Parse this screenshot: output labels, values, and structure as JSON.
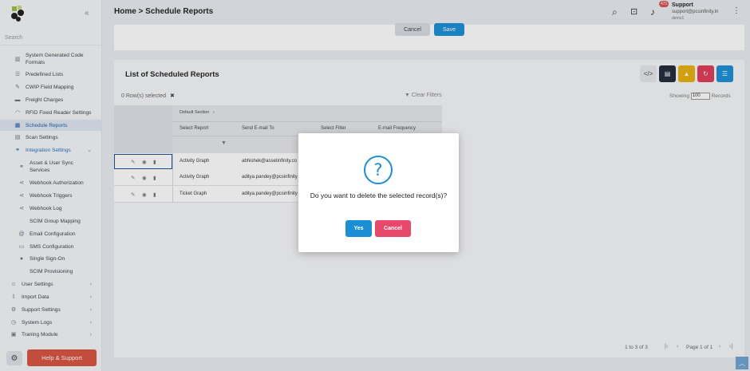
{
  "sidebar": {
    "search_placeholder": "Search",
    "items": [
      {
        "label": "System Generated Code Formats",
        "icon": "barcode-icon"
      },
      {
        "label": "Predefined Lists",
        "icon": "list-icon"
      },
      {
        "label": "CWIP Field Mapping",
        "icon": "pencil-icon"
      },
      {
        "label": "Freight Charges",
        "icon": "truck-icon"
      },
      {
        "label": "RFID Fixed Reader Settings",
        "icon": "wifi-icon"
      },
      {
        "label": "Schedule Reports",
        "icon": "calendar-icon"
      },
      {
        "label": "Scan Settings",
        "icon": "scan-icon"
      },
      {
        "label": "Integration Settings",
        "icon": "link-icon"
      },
      {
        "label": "Asset & User Sync Services",
        "icon": "link-icon"
      },
      {
        "label": "Webhook Authorization",
        "icon": "share-icon"
      },
      {
        "label": "Webhook Triggers",
        "icon": "share-icon"
      },
      {
        "label": "Webhook Log",
        "icon": "share-icon"
      },
      {
        "label": "SCIM Group Mapping",
        "icon": ""
      },
      {
        "label": "Email Configuration",
        "icon": "at-icon"
      },
      {
        "label": "SMS Configuration",
        "icon": "sms-icon"
      },
      {
        "label": "Single Sign-On",
        "icon": "user-icon"
      },
      {
        "label": "SCIM Provisioning",
        "icon": ""
      },
      {
        "label": "User Settings",
        "icon": "users-icon"
      },
      {
        "label": "Import Data",
        "icon": "import-icon"
      },
      {
        "label": "Support Settings",
        "icon": "gears-icon"
      },
      {
        "label": "System Logs",
        "icon": "log-icon"
      },
      {
        "label": "Traning Module",
        "icon": "training-icon"
      }
    ],
    "help_label": "Help & Support"
  },
  "header": {
    "breadcrumb": "Home > Schedule Reports",
    "notification_count": "471",
    "user_name": "Support",
    "user_email": "support@pcsinfinity.in",
    "user_role": "demo1"
  },
  "form": {
    "cancel_label": "Cancel",
    "save_label": "Save"
  },
  "list": {
    "title": "List of Scheduled Reports",
    "rows_selected": "0 Row(s) selected",
    "clear_filters": "Clear Filters",
    "showing_label": "Showing",
    "page_size": "100",
    "records_label": "Records",
    "group_label": "Default Section",
    "columns": [
      "Select Report",
      "Send E-mail To",
      "Select Filter",
      "E-mail Frequency"
    ],
    "rows": [
      {
        "report": "Activity Graph",
        "email": "abhishek@assetinfinity.co"
      },
      {
        "report": "Activity Graph",
        "email": "aditya.pandey@pcsinfinity"
      },
      {
        "report": "Ticket Graph",
        "email": "aditya.pandey@pcsinfinity"
      }
    ],
    "paging": "1 to 3 of 3",
    "page_of": "Page 1 of 1"
  },
  "colors": {
    "primary": "#1a8fd6",
    "danger": "#e8486a",
    "help": "#d9523f",
    "dark": "#1f2937",
    "warning": "#e8b10c",
    "refresh": "#e03a57"
  },
  "modal": {
    "message": "Do you want to delete the selected record(s)?",
    "yes_label": "Yes",
    "cancel_label": "Cancel"
  }
}
